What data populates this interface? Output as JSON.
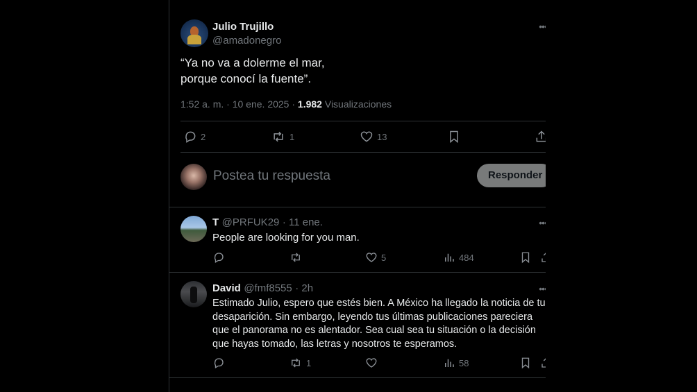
{
  "main_post": {
    "author_name": "Julio Trujillo",
    "author_handle": "@amadonegro",
    "text_line1": "“Ya no va a dolerme el mar,",
    "text_line2": "porque conocí la fuente”.",
    "time": "1:52 a. m.",
    "date": "10 ene. 2025",
    "separator": "·",
    "views_count": "1.982",
    "views_label": "Visualizaciones",
    "replies": "2",
    "reposts": "1",
    "likes": "13",
    "more_icon": "more-dots-icon"
  },
  "reply_composer": {
    "placeholder": "Postea tu respuesta",
    "button_label": "Responder"
  },
  "replies": [
    {
      "author_name": "T",
      "author_handle": "@PRFUK29",
      "time": "· 11 ene.",
      "text": "People are looking for you man.",
      "replies": "",
      "reposts": "",
      "likes": "5",
      "views": "484"
    },
    {
      "author_name": "David",
      "author_handle": "@fmf8555",
      "time": "· 2h",
      "text_lines": [
        "Estimado Julio, espero que estés bien. A México ha llegado la noticia de tu",
        "desaparición. Sin embargo, leyendo tus últimas publicaciones pareciera",
        "que el panorama no es alentador. Sea cual sea tu situación o la decisión",
        "que hayas tomado, las letras y nosotros te esperamos."
      ],
      "replies": "",
      "reposts": "1",
      "likes": "",
      "views": "58"
    }
  ],
  "colors": {
    "background": "#000000",
    "text": "#e7e9ea",
    "muted": "#71767b",
    "divider": "#2f3336",
    "button_bg": "#787a7a"
  }
}
